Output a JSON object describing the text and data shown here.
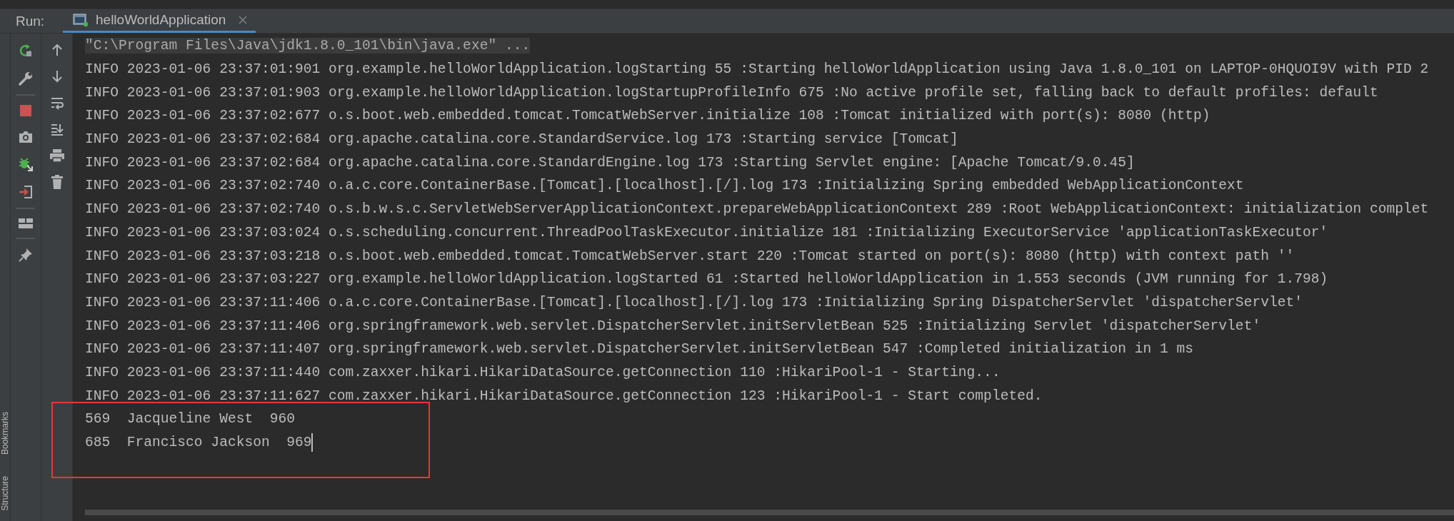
{
  "run_panel": {
    "label": "Run:",
    "tabs": [
      {
        "label": "helloWorldApplication",
        "selected": true
      }
    ]
  },
  "side_labels": [
    "Bookmarks",
    "Structure"
  ],
  "console": {
    "lines": [
      {
        "kind": "command",
        "text": "\"C:\\Program Files\\Java\\jdk1.8.0_101\\bin\\java.exe\" ...",
        "cursor": false
      },
      {
        "kind": "log",
        "text": "INFO 2023-01-06 23:37:01:901 org.example.helloWorldApplication.logStarting 55 :Starting helloWorldApplication using Java 1.8.0_101 on LAPTOP-0HQUOI9V with PID 2",
        "cursor": false
      },
      {
        "kind": "log",
        "text": "INFO 2023-01-06 23:37:01:903 org.example.helloWorldApplication.logStartupProfileInfo 675 :No active profile set, falling back to default profiles: default",
        "cursor": false
      },
      {
        "kind": "log",
        "text": "INFO 2023-01-06 23:37:02:677 o.s.boot.web.embedded.tomcat.TomcatWebServer.initialize 108 :Tomcat initialized with port(s): 8080 (http)",
        "cursor": false
      },
      {
        "kind": "log",
        "text": "INFO 2023-01-06 23:37:02:684 org.apache.catalina.core.StandardService.log 173 :Starting service [Tomcat]",
        "cursor": false
      },
      {
        "kind": "log",
        "text": "INFO 2023-01-06 23:37:02:684 org.apache.catalina.core.StandardEngine.log 173 :Starting Servlet engine: [Apache Tomcat/9.0.45]",
        "cursor": false
      },
      {
        "kind": "log",
        "text": "INFO 2023-01-06 23:37:02:740 o.a.c.core.ContainerBase.[Tomcat].[localhost].[/].log 173 :Initializing Spring embedded WebApplicationContext",
        "cursor": false
      },
      {
        "kind": "log",
        "text": "INFO 2023-01-06 23:37:02:740 o.s.b.w.s.c.ServletWebServerApplicationContext.prepareWebApplicationContext 289 :Root WebApplicationContext: initialization complet",
        "cursor": false
      },
      {
        "kind": "log",
        "text": "INFO 2023-01-06 23:37:03:024 o.s.scheduling.concurrent.ThreadPoolTaskExecutor.initialize 181 :Initializing ExecutorService 'applicationTaskExecutor'",
        "cursor": false
      },
      {
        "kind": "log",
        "text": "INFO 2023-01-06 23:37:03:218 o.s.boot.web.embedded.tomcat.TomcatWebServer.start 220 :Tomcat started on port(s): 8080 (http) with context path ''",
        "cursor": false
      },
      {
        "kind": "log",
        "text": "INFO 2023-01-06 23:37:03:227 org.example.helloWorldApplication.logStarted 61 :Started helloWorldApplication in 1.553 seconds (JVM running for 1.798)",
        "cursor": false
      },
      {
        "kind": "log",
        "text": "INFO 2023-01-06 23:37:11:406 o.a.c.core.ContainerBase.[Tomcat].[localhost].[/].log 173 :Initializing Spring DispatcherServlet 'dispatcherServlet'",
        "cursor": false
      },
      {
        "kind": "log",
        "text": "INFO 2023-01-06 23:37:11:406 org.springframework.web.servlet.DispatcherServlet.initServletBean 525 :Initializing Servlet 'dispatcherServlet'",
        "cursor": false
      },
      {
        "kind": "log",
        "text": "INFO 2023-01-06 23:37:11:407 org.springframework.web.servlet.DispatcherServlet.initServletBean 547 :Completed initialization in 1 ms",
        "cursor": false
      },
      {
        "kind": "log",
        "text": "INFO 2023-01-06 23:37:11:440 com.zaxxer.hikari.HikariDataSource.getConnection 110 :HikariPool-1 - Starting...",
        "cursor": false
      },
      {
        "kind": "log",
        "text": "INFO 2023-01-06 23:37:11:627 com.zaxxer.hikari.HikariDataSource.getConnection 123 :HikariPool-1 - Start completed.",
        "cursor": false
      },
      {
        "kind": "output",
        "text": "569  Jacqueline West  960",
        "cursor": false
      },
      {
        "kind": "output",
        "text": "685  Francisco Jackson  969",
        "cursor": true
      }
    ]
  }
}
